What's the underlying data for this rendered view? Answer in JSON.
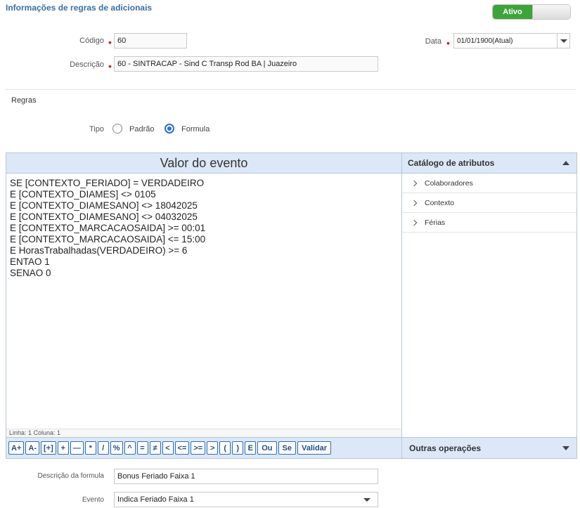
{
  "header": {
    "title": "Informações de regras de adicionais",
    "toggle_label": "Ativo"
  },
  "form": {
    "codigo_label": "Código",
    "codigo_value": "60",
    "descricao_label": "Descrição",
    "descricao_value": "60 - SINTRACAP - Sind C Transp Rod BA | Juazeiro",
    "data_label": "Data",
    "data_value": "01/01/1900(Atual)"
  },
  "regras": {
    "section_label": "Regras",
    "tipo_label": "Tipo",
    "options": [
      {
        "label": "Padrão",
        "selected": false
      },
      {
        "label": "Formula",
        "selected": true
      }
    ]
  },
  "editor": {
    "title": "Valor do evento",
    "lines": [
      "SE [CONTEXTO_FERIADO] = VERDADEIRO",
      "E [CONTEXTO_DIAMES] <> 0105",
      "E [CONTEXTO_DIAMESANO] <> 18042025",
      "E [CONTEXTO_DIAMESANO] <> 04032025",
      "E [CONTEXTO_MARCACAOSAIDA] >= 00:01",
      "E [CONTEXTO_MARCACAOSAIDA] <= 15:00",
      "E HorasTrabalhadas(VERDADEIRO) >= 6",
      "ENTAO 1",
      "SENAO 0"
    ],
    "status": "Linha: 1 Coluna: 1",
    "toolbar": [
      "A+",
      "A-",
      "[+]",
      "+",
      "—",
      "*",
      "/",
      "%",
      "^",
      "=",
      "≠",
      "<",
      "<=",
      ">=",
      ">",
      "(",
      ")",
      "E",
      "Ou",
      "Se",
      "Validar"
    ]
  },
  "catalog": {
    "title": "Catálogo de atributos",
    "items": [
      "Colaboradores",
      "Contexto",
      "Férias"
    ],
    "footer": "Outras operações"
  },
  "bottom": {
    "descricao_formula_label": "Descrição da formula",
    "descricao_formula_value": "Bonus Feriado Faixa 1",
    "evento_label": "Evento",
    "evento_value": "Indica Feriado Faixa 1"
  },
  "colors": {
    "title": "#3a6ea5",
    "active_green": "#3fa33b",
    "panel_header": "#dce8f7",
    "required": "#d11a1a",
    "radio_selected": "#2a6fd6"
  }
}
